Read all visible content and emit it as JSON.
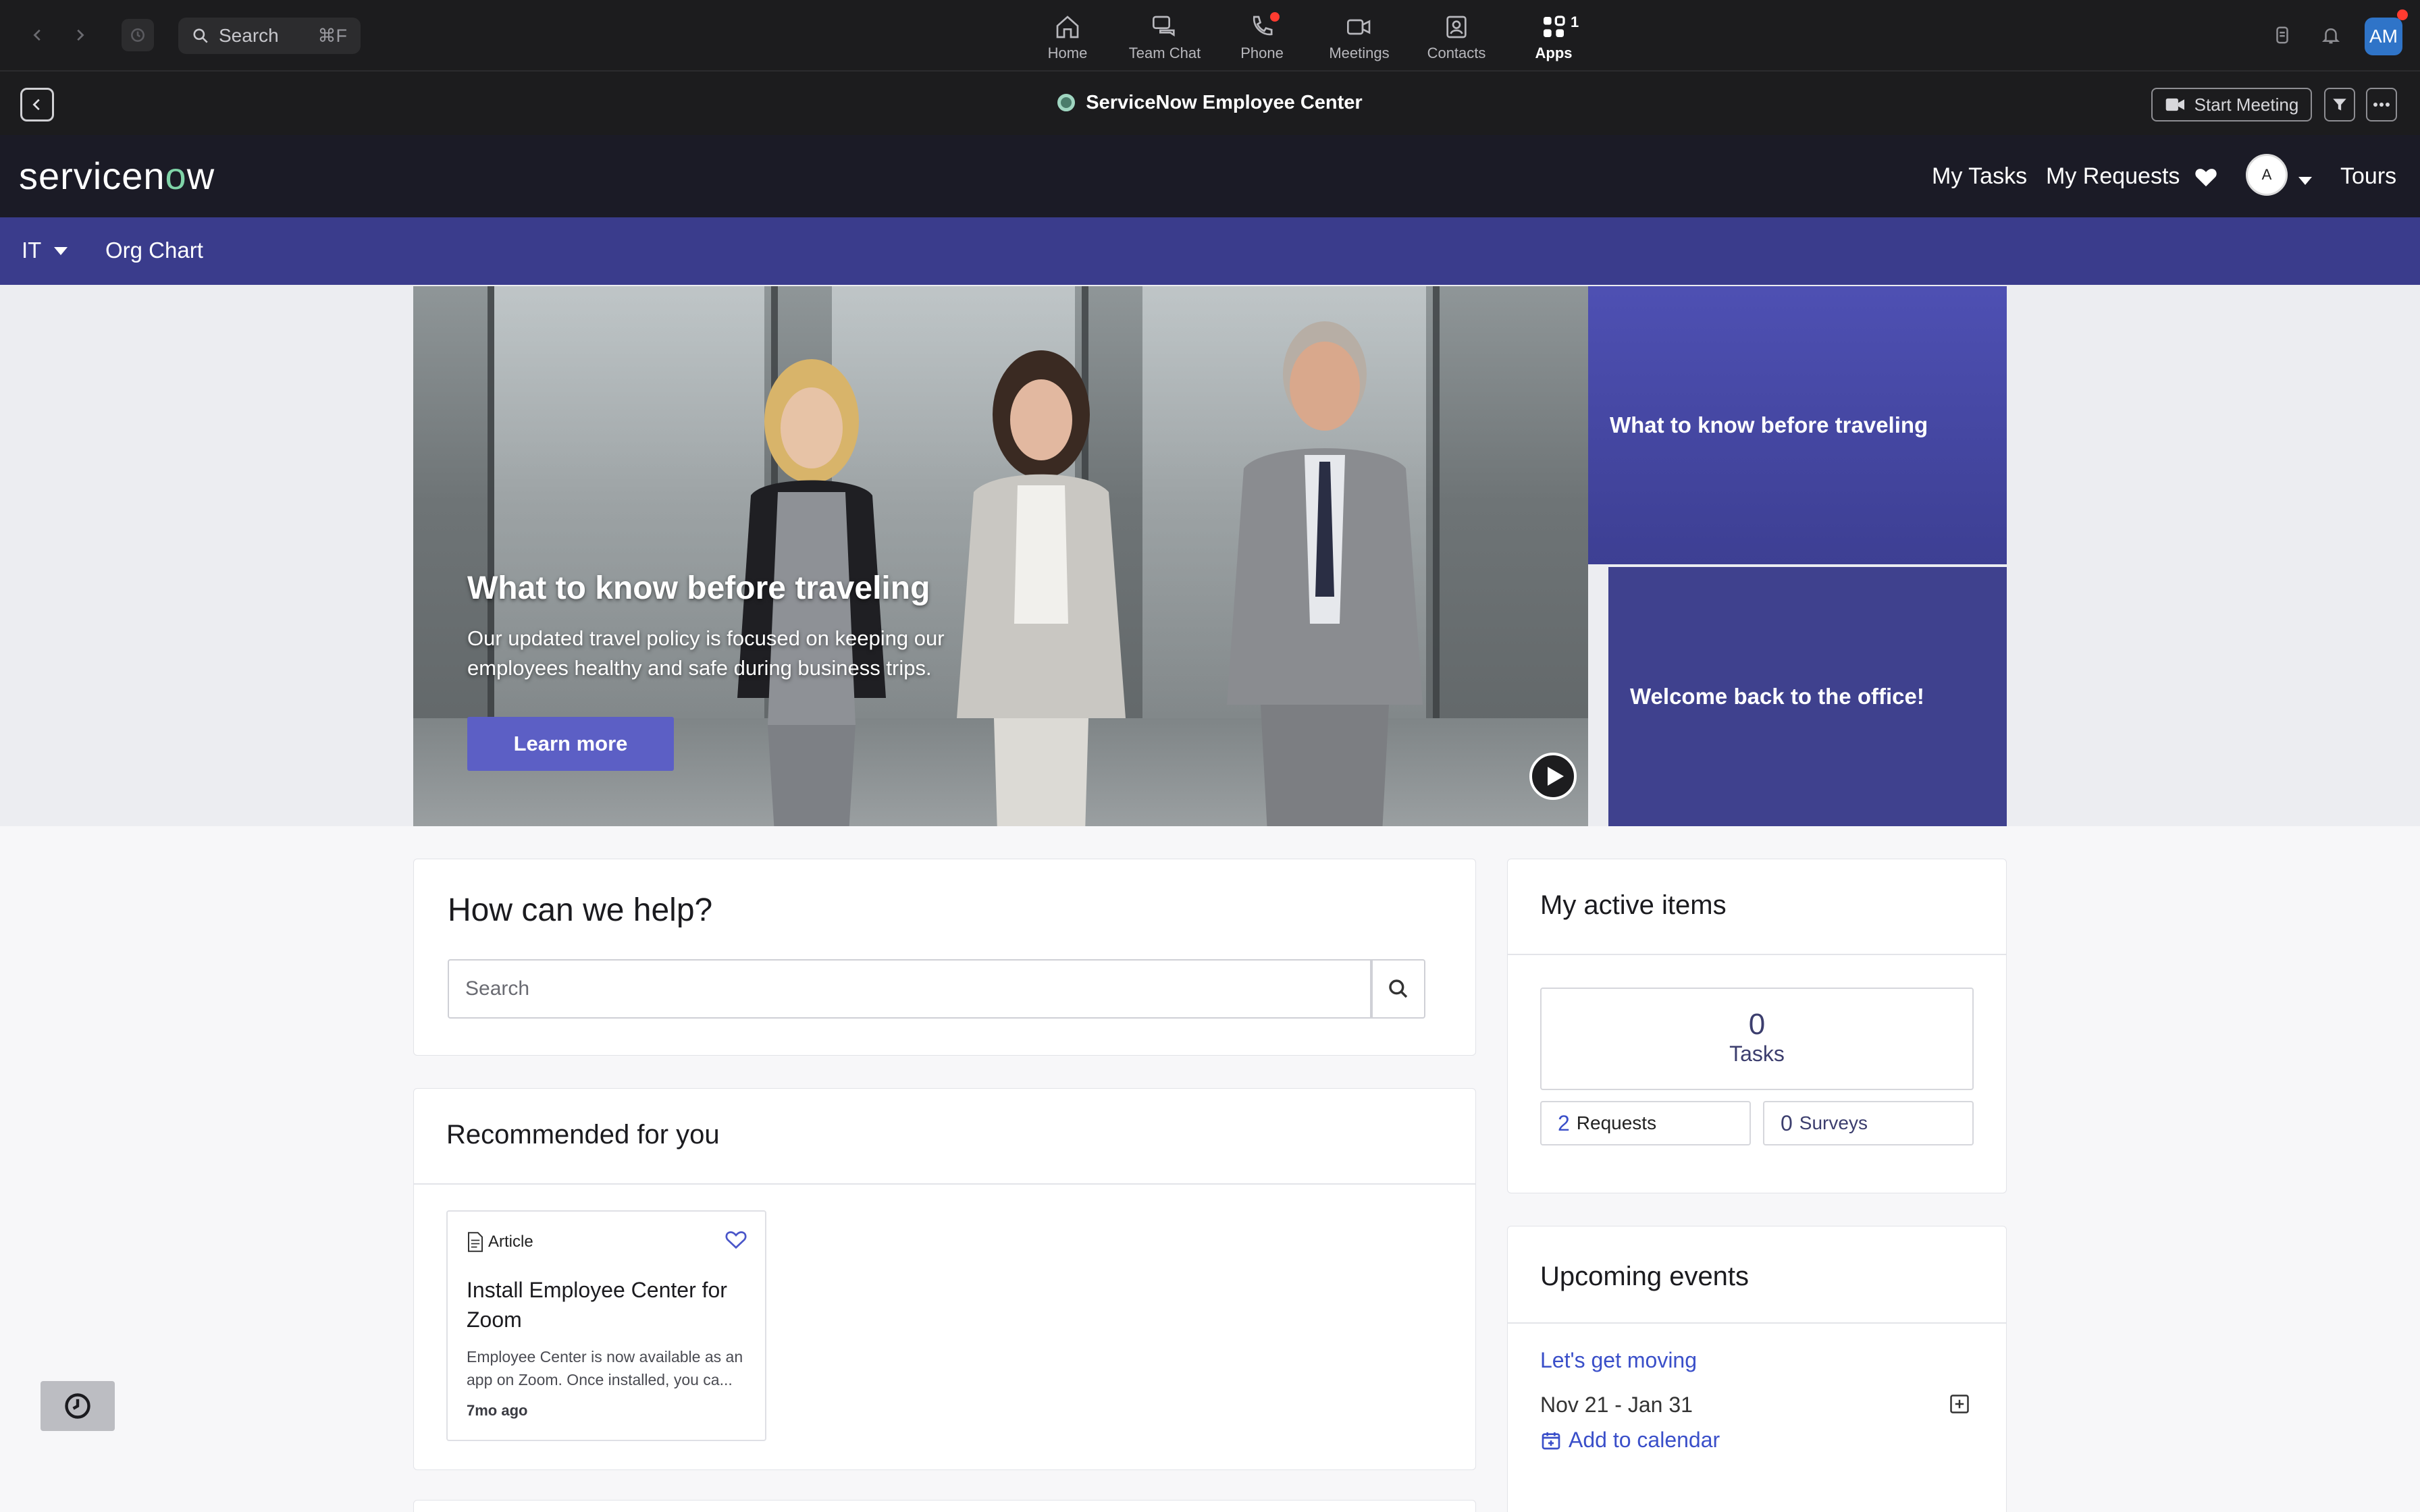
{
  "zoom_bar": {
    "search_label": "Search",
    "search_shortcut": "⌘F",
    "tabs": [
      {
        "label": "Home"
      },
      {
        "label": "Team Chat"
      },
      {
        "label": "Phone"
      },
      {
        "label": "Meetings"
      },
      {
        "label": "Contacts"
      },
      {
        "label": "Apps",
        "badge": "1"
      }
    ],
    "user_initials": "AM"
  },
  "app_header": {
    "title": "ServiceNow Employee Center",
    "start_meeting_label": "Start Meeting"
  },
  "servicenow_header": {
    "logo_text_pre": "servicen",
    "logo_text_o": "o",
    "logo_text_post": "w",
    "my_tasks": "My Tasks",
    "my_requests": "My Requests",
    "avatar_initial": "A",
    "tours": "Tours"
  },
  "nav": {
    "it": "IT",
    "org_chart": "Org Chart"
  },
  "hero": {
    "title": "What to know before traveling",
    "description": "Our updated travel policy is focused on keeping our employees healthy and safe during business trips.",
    "cta": "Learn more",
    "side_cards": [
      {
        "label": "What to know before traveling"
      },
      {
        "label": "Welcome back to the office!"
      }
    ]
  },
  "help": {
    "title": "How can we help?",
    "search_placeholder": "Search"
  },
  "recommended": {
    "title": "Recommended for you",
    "items": [
      {
        "type": "Article",
        "title": "Install Employee Center for Zoom",
        "description": "Employee Center is now available as an app on Zoom. Once installed, you ca...",
        "age": "7mo ago"
      }
    ]
  },
  "active_items": {
    "title": "My active items",
    "tasks_count": "0",
    "tasks_label": "Tasks",
    "requests_count": "2",
    "requests_label": "Requests",
    "surveys_count": "0",
    "surveys_label": "Surveys"
  },
  "events": {
    "title": "Upcoming events",
    "items": [
      {
        "name": "Let's get moving",
        "date": "Nov 21 - Jan 31",
        "add_label": "Add to calendar"
      }
    ]
  },
  "colors": {
    "zoom_bg": "#1c1c1e",
    "sn_header": "#1b1b26",
    "sn_nav": "#3a3c8c",
    "accent": "#5c5fc5",
    "link": "#3a4fc9"
  }
}
